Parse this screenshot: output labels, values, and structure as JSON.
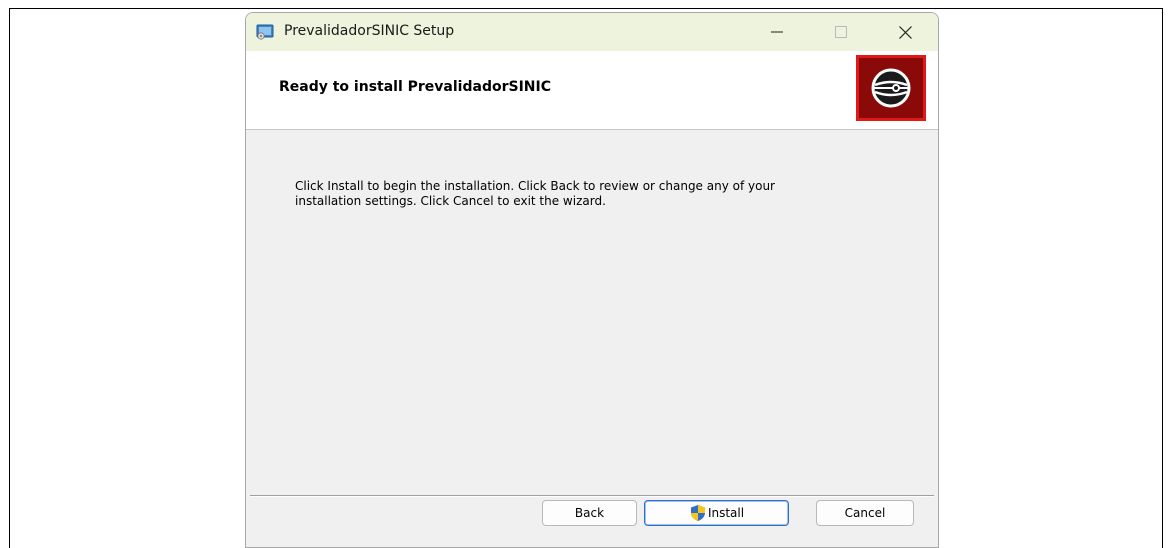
{
  "window": {
    "title": "PrevalidadorSINIC Setup",
    "controls": {
      "minimize": "—",
      "maximize": "☐",
      "close": "✕"
    }
  },
  "header": {
    "title": "Ready to install PrevalidadorSINIC",
    "logo_icon": "disc-icon"
  },
  "body": {
    "line1": "Click Install to begin the installation. Click Back to review or change any of your",
    "line2": "installation settings. Click Cancel to exit the wizard."
  },
  "buttons": {
    "back": "Back",
    "install": "Install",
    "cancel": "Cancel"
  },
  "colors": {
    "titlebar": "#eef3dd",
    "logo_bg": "#8a0a0a",
    "logo_border": "#e01818",
    "install_border": "#2f6fcb"
  }
}
